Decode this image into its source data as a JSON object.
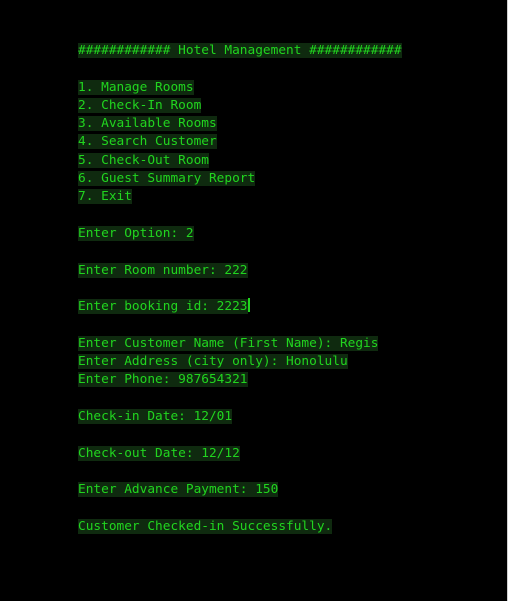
{
  "terminal": {
    "header": "############ Hotel Management ############",
    "menu": [
      "1. Manage Rooms",
      "2. Check-In Room",
      "3. Available Rooms",
      "4. Search Customer",
      "5. Check-Out Room",
      "6. Guest Summary Report",
      "7. Exit"
    ],
    "option_prompt": "Enter Option: 2",
    "room_prompt": "Enter Room number: 222",
    "booking_prompt": "Enter booking id: 2223",
    "name_prompt": "Enter Customer Name (First Name): Regis",
    "address_prompt": "Enter Address (city only): Honolulu",
    "phone_prompt": "Enter Phone: 987654321",
    "checkin_prompt": "Check-in Date: 12/01",
    "checkout_prompt": "Check-out Date: 12/12",
    "advance_prompt": "Enter Advance Payment: 150",
    "success_message": "Customer Checked-in Successfully."
  },
  "colors": {
    "background": "#000000",
    "text": "#21d51f"
  }
}
